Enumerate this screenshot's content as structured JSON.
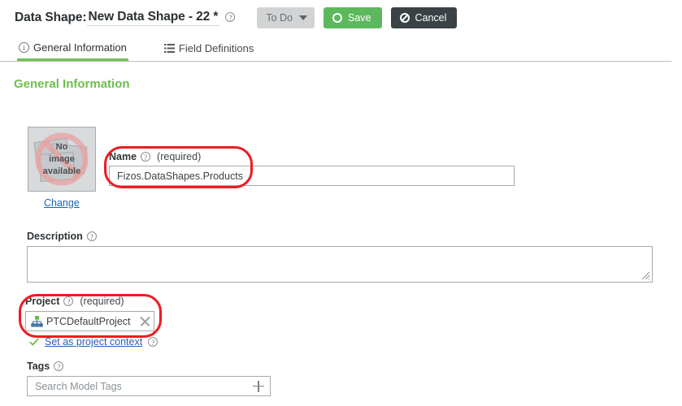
{
  "header": {
    "title_prefix": "Data Shape:",
    "title_name": "New Data Shape - 22 *",
    "title_help_icon": "help-icon",
    "status_button": {
      "label": "To Do",
      "icon": "chevron-down-icon"
    },
    "save_button": {
      "label": "Save",
      "icon": "circle-icon"
    },
    "cancel_button": {
      "label": "Cancel",
      "icon": "no-entry-icon"
    }
  },
  "tabs": [
    {
      "label": "General Information",
      "icon": "info-icon",
      "active": true
    },
    {
      "label": "Field Definitions",
      "icon": "list-icon",
      "active": false
    }
  ],
  "section": {
    "title": "General Information"
  },
  "image": {
    "placeholder_line1": "No",
    "placeholder_line2": "image",
    "placeholder_line3": "available",
    "change_link": "Change"
  },
  "name_field": {
    "label": "Name",
    "help_icon": "help-icon",
    "required_text": "(required)",
    "value": "Fizos.DataShapes.Products"
  },
  "description_field": {
    "label": "Description",
    "help_icon": "help-icon",
    "value": ""
  },
  "project_field": {
    "label": "Project",
    "help_icon": "help-icon",
    "required_text": "(required)",
    "chip_label": "PTCDefaultProject",
    "chip_icon": "org-chart-icon",
    "chip_remove_icon": "close-icon",
    "context_check_icon": "check-icon",
    "context_link": "Set as project context",
    "context_help_icon": "help-icon"
  },
  "tags_field": {
    "label": "Tags",
    "help_icon": "help-icon",
    "placeholder": "Search Model Tags",
    "add_icon": "plus-icon"
  },
  "annotations": [
    {
      "name": "name-field-highlight",
      "shape": "rounded-rect",
      "color": "#ee1b20"
    },
    {
      "name": "project-field-highlight",
      "shape": "rounded-rect",
      "color": "#ee1b20"
    }
  ],
  "colors": {
    "accent_green": "#6cbf4b",
    "save_green": "#5cb85c",
    "cancel_dark": "#3b4245",
    "link_blue": "#1a66b5",
    "annotation_red": "#ee1b20"
  }
}
